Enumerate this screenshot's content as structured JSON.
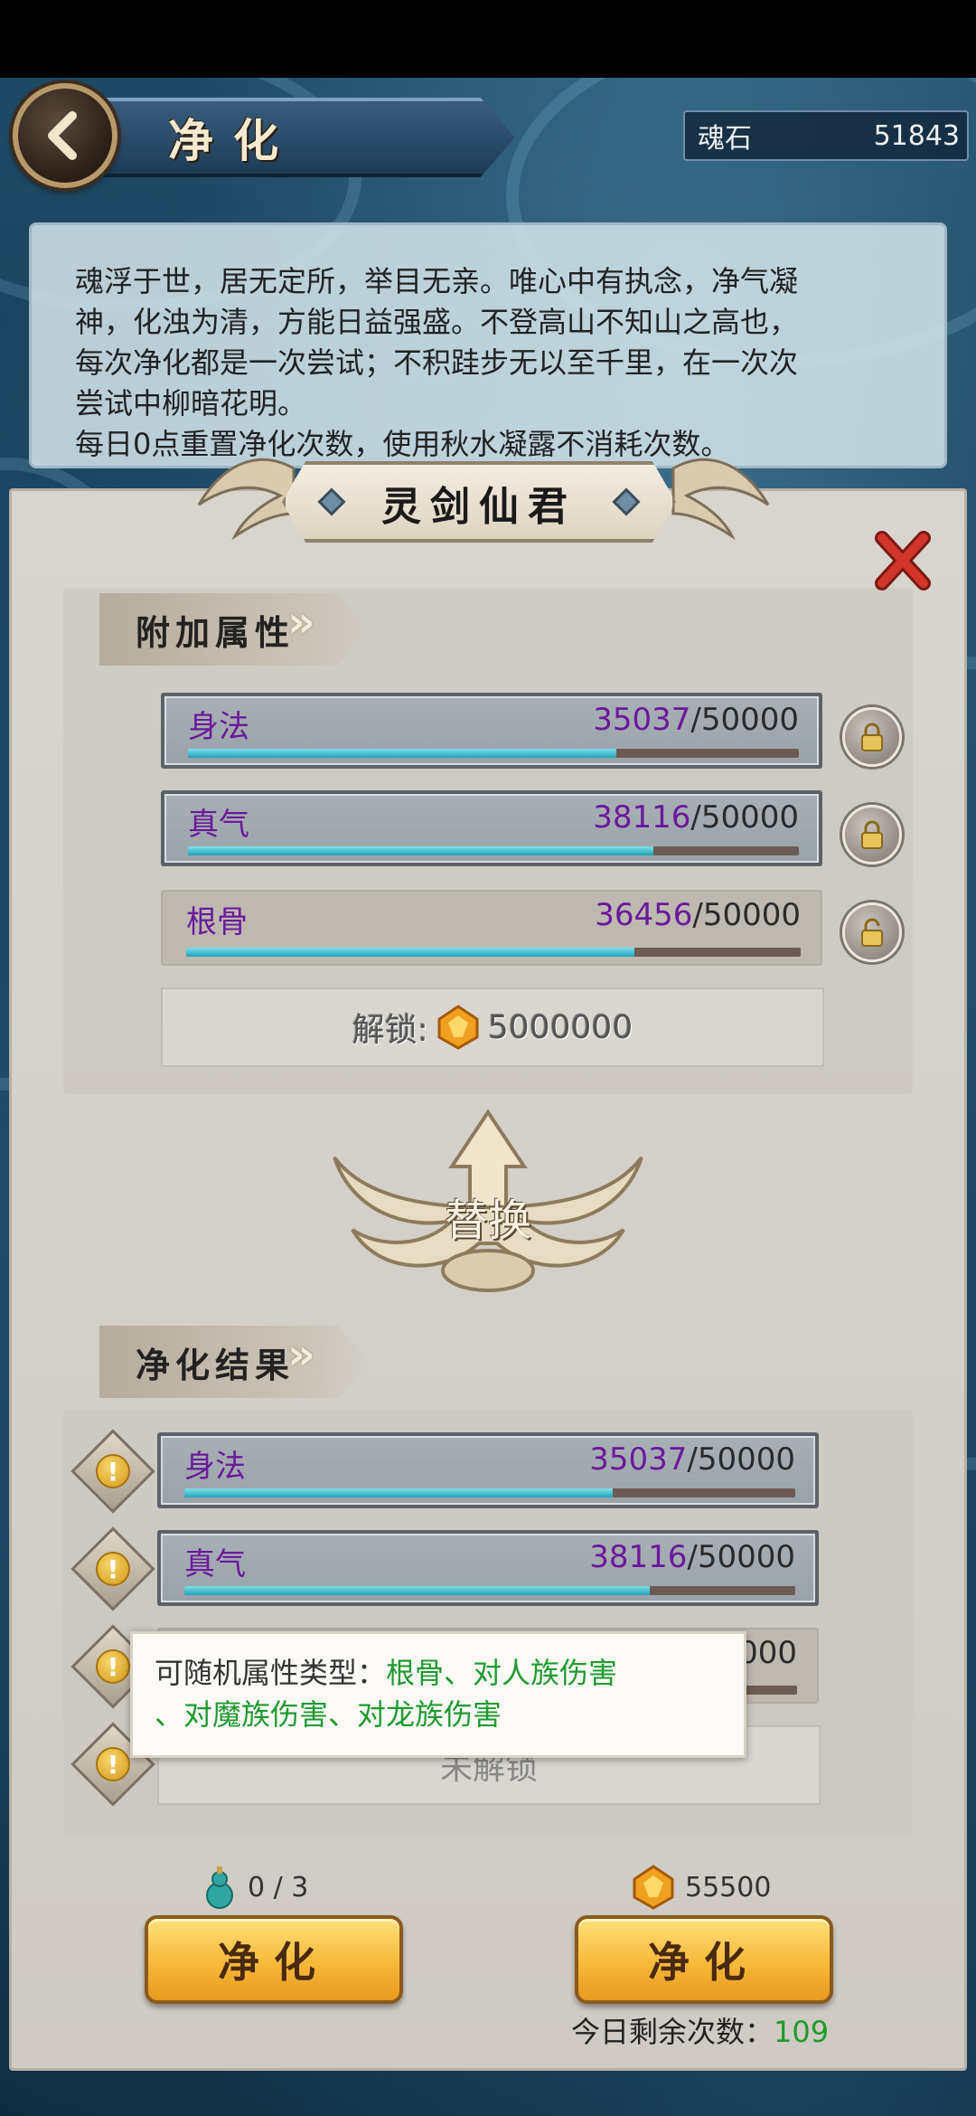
{
  "header": {
    "title": "净化",
    "currency_label": "魂石",
    "currency_value": "51843"
  },
  "description": {
    "lines": [
      "魂浮于世，居无定所，举目无亲。唯心中有执念，净气凝",
      "神，化浊为清，方能日益强盛。不登高山不知山之高也，",
      "每次净化都是一次尝试；不积跬步无以至千里，在一次次",
      "尝试中柳暗花明。",
      "每日0点重置净化次数，使用秋水凝露不消耗次数。"
    ]
  },
  "character_name": "灵剑仙君",
  "attributes_section": {
    "title": "附加属性",
    "rows": [
      {
        "name": "身法",
        "current": "35037",
        "max": "/50000",
        "progress": 0.70074,
        "locked": true
      },
      {
        "name": "真气",
        "current": "38116",
        "max": "/50000",
        "progress": 0.76232,
        "locked": true
      },
      {
        "name": "根骨",
        "current": "36456",
        "max": "/50000",
        "progress": 0.72912,
        "locked": false
      }
    ],
    "unlock_label": "解锁:",
    "unlock_cost": "5000000"
  },
  "replace_label": "替换",
  "result_section": {
    "title": "净化结果",
    "rows": [
      {
        "name": "身法",
        "current": "35037",
        "max": "/50000",
        "progress": 0.70074
      },
      {
        "name": "真气",
        "current": "38116",
        "max": "/50000",
        "progress": 0.76232
      },
      {
        "name": "",
        "current": "",
        "max": "000",
        "progress": 0.73
      }
    ],
    "not_unlocked": "未解锁"
  },
  "tooltip": {
    "prefix": "可随机属性类型：",
    "types_line1": "根骨、对人族伤害",
    "types_line2": "、对魔族伤害、对龙族伤害"
  },
  "bottom": {
    "potion_count": "0 / 3",
    "gem_cost": "55500",
    "purify_button_left": "净化",
    "purify_button_right": "净化",
    "remaining_label": "今日剩余次数：",
    "remaining_value": "109"
  },
  "icons": {
    "back": "back-arrow-icon",
    "lock": "lock-icon",
    "unlock": "unlock-icon",
    "gem": "gem-icon",
    "warning": "warning-icon",
    "close": "close-icon",
    "potion": "gourd-icon"
  },
  "colors": {
    "accent_purple": "#6a1a9a",
    "progress_cyan": "#1fa3b8",
    "button_gold": "#f6b93a",
    "close_red": "#d2352a",
    "green_text": "#1f9a2f"
  }
}
